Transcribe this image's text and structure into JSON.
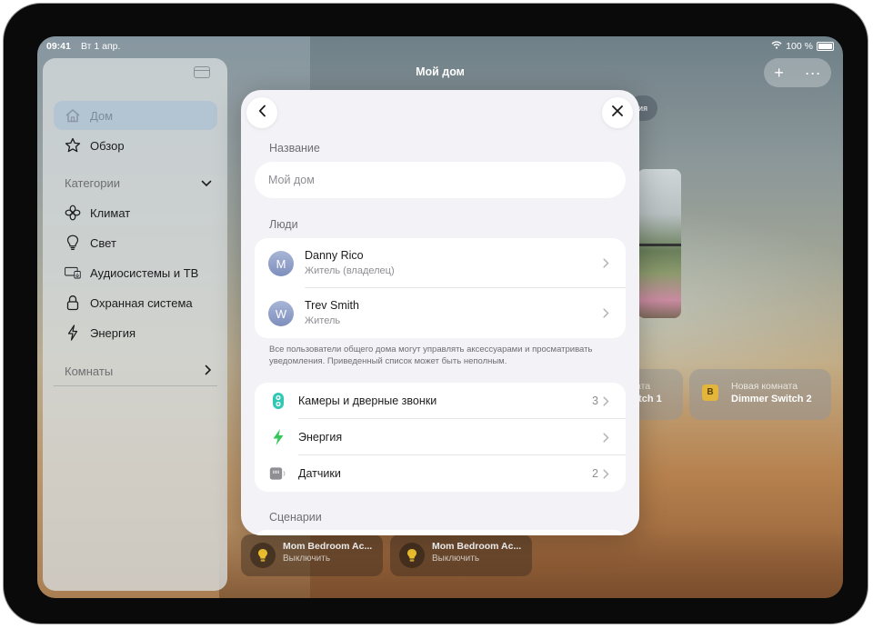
{
  "status_bar": {
    "time": "09:41",
    "date": "Вт 1 апр.",
    "battery": "100 %"
  },
  "sidebar": {
    "items": [
      {
        "label": "Дом",
        "icon": "house-icon",
        "active": true
      },
      {
        "label": "Обзор",
        "icon": "star-icon",
        "active": false
      }
    ],
    "categories_label": "Категории",
    "categories": [
      {
        "label": "Климат",
        "icon": "fan-icon"
      },
      {
        "label": "Свет",
        "icon": "lightbulb-icon"
      },
      {
        "label": "Аудиосистемы и ТВ",
        "icon": "tv-speaker-icon"
      },
      {
        "label": "Охранная система",
        "icon": "lock-icon"
      },
      {
        "label": "Энергия",
        "icon": "bolt-icon"
      }
    ],
    "rooms_label": "Комнаты"
  },
  "home": {
    "title": "Мой дом",
    "chip_partial": "ия",
    "tile_under": {
      "line1": "ата",
      "line2": "itch 1"
    },
    "tile": {
      "room": "Новая комната",
      "name": "Dimmer Switch 2",
      "badge": "B"
    },
    "bulb_tiles": [
      {
        "name": "Mom Bedroom Ac...",
        "state": "Выключить"
      },
      {
        "name": "Mom Bedroom Ac...",
        "state": "Выключить"
      }
    ]
  },
  "modal": {
    "name_header": "Название",
    "name_placeholder": "Мой дом",
    "people_header": "Люди",
    "people": [
      {
        "initial": "M",
        "name": "Danny Rico",
        "role": "Житель (владелец)"
      },
      {
        "initial": "W",
        "name": "Trev Smith",
        "role": "Житель"
      }
    ],
    "footnote": "Все пользователи общего дома могут управлять аксессуарами и просматривать уведомления. Приведенный список может быть неполным.",
    "categories": [
      {
        "label": "Камеры и дверные звонки",
        "count": "3",
        "icon": "camera-doorbell-icon",
        "color": "#30c8b4"
      },
      {
        "label": "Энергия",
        "count": "",
        "icon": "bolt-icon",
        "color": "#34c759"
      },
      {
        "label": "Датчики",
        "count": "2",
        "icon": "sensor-icon",
        "color": "#8e8e93"
      }
    ],
    "scenarios_header": "Сценарии"
  }
}
